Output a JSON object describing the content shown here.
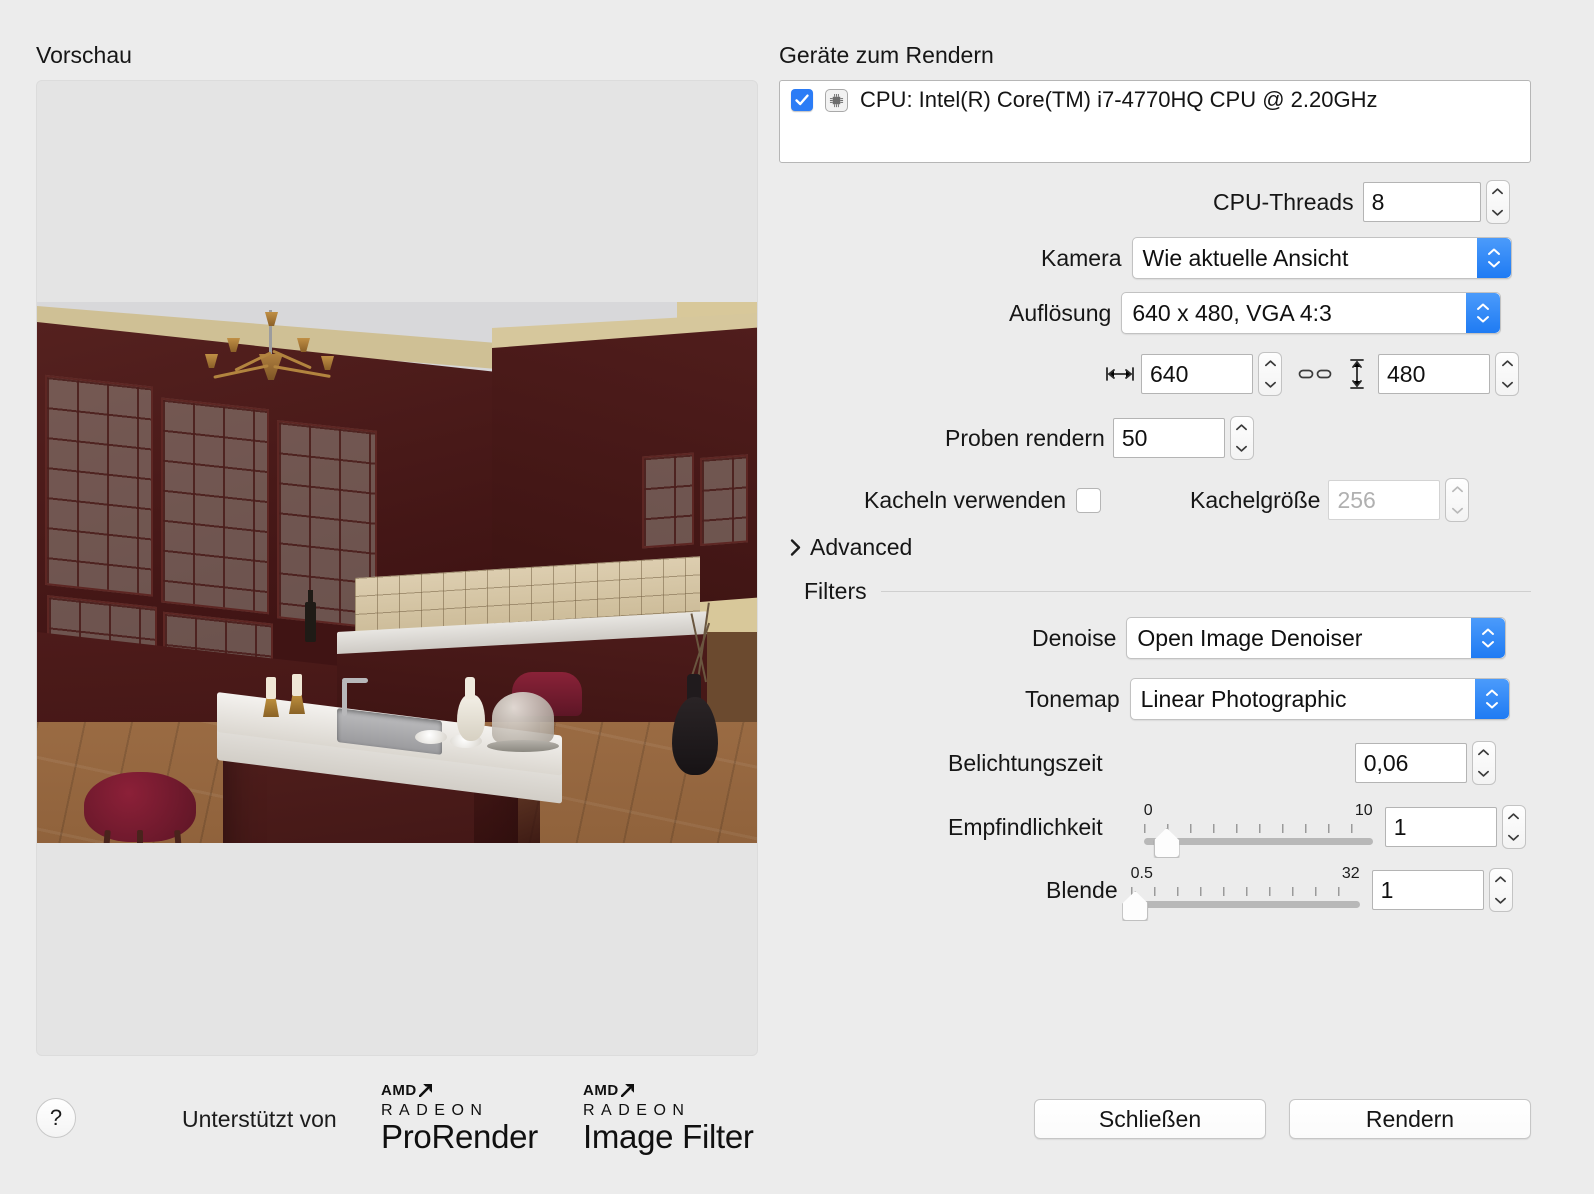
{
  "preview": {
    "label": "Vorschau",
    "scene_description": "3D gerenderte Küche mit dunklen Kirschholzschränken, Kochinsel, Barhocker und Kronleuchter"
  },
  "devices": {
    "label": "Geräte zum Rendern",
    "items": [
      {
        "checked": true,
        "icon": "cpu-icon",
        "name": "CPU: Intel(R) Core(TM) i7-4770HQ CPU @ 2.20GHz"
      }
    ]
  },
  "settings": {
    "cpu_threads": {
      "label": "CPU-Threads",
      "value": "8"
    },
    "camera": {
      "label": "Kamera",
      "value": "Wie aktuelle Ansicht"
    },
    "resolution": {
      "label": "Auflösung",
      "value": "640 x 480, VGA 4:3"
    },
    "width": {
      "value": "640",
      "icon": "width-arrows-icon"
    },
    "link": {
      "icon": "broken-link-icon"
    },
    "height": {
      "value": "480",
      "icon": "height-arrows-icon"
    },
    "samples": {
      "label": "Proben rendern",
      "value": "50"
    },
    "use_tiles": {
      "label": "Kacheln verwenden",
      "checked": false
    },
    "tile_size": {
      "label": "Kachelgröße",
      "value": "256",
      "disabled": true
    },
    "advanced": {
      "label": "Advanced",
      "expanded": false,
      "icon": "chevron-right-icon"
    }
  },
  "filters": {
    "label": "Filters",
    "denoise": {
      "label": "Denoise",
      "value": "Open Image Denoiser"
    },
    "tonemap": {
      "label": "Tonemap",
      "value": "Linear Photographic"
    },
    "exposure": {
      "label": "Belichtungszeit",
      "value": "0,06"
    },
    "sensitivity": {
      "label": "Empfindlichkeit",
      "value": "1",
      "min": "0",
      "max": "10",
      "min_num": 0,
      "max_num": 10,
      "current": 1
    },
    "aperture": {
      "label": "Blende",
      "value": "1",
      "min": "0.5",
      "max": "32",
      "min_num": 0.5,
      "max_num": 32,
      "current": 1
    }
  },
  "footer": {
    "help": "?",
    "supported_by": "Unterstützt von",
    "logos": [
      {
        "amd": "AMD",
        "radeon": "RADEON",
        "product": "ProRender"
      },
      {
        "amd": "AMD",
        "radeon": "RADEON",
        "product": "Image Filter"
      }
    ],
    "close_button": "Schließen",
    "render_button": "Rendern"
  },
  "colors": {
    "accent": "#2b7cf6",
    "window_bg": "#ececec",
    "preview_bg": "#e4e4e4",
    "field_bg": "#ffffff",
    "disabled_text": "#b0b0b0"
  }
}
